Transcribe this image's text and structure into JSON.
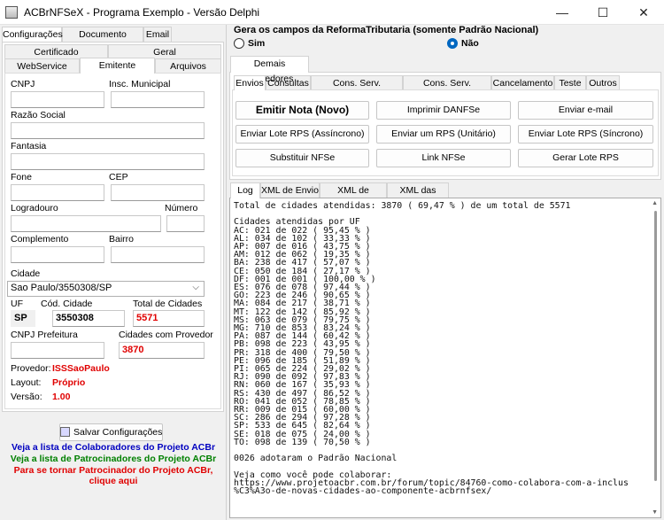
{
  "window": {
    "title": "ACBrNFSeX - Programa Exemplo - Versão Delphi",
    "minimize": "—",
    "maximize": "☐",
    "close": "✕"
  },
  "left": {
    "top_tabs": [
      "Configurações",
      "Documento Auxiliar",
      "Email"
    ],
    "tabs_row1": [
      "Certificado",
      "Geral"
    ],
    "tabs_row2": [
      "WebService",
      "Emitente",
      "Arquivos"
    ],
    "fields": {
      "cnpj_label": "CNPJ",
      "insc_municipal_label": "Insc. Municipal",
      "razao_social_label": "Razão Social",
      "fantasia_label": "Fantasia",
      "fone_label": "Fone",
      "cep_label": "CEP",
      "logradouro_label": "Logradouro",
      "numero_label": "Número",
      "complemento_label": "Complemento",
      "bairro_label": "Bairro",
      "cidade_label": "Cidade",
      "cidade_value": "Sao Paulo/3550308/SP",
      "uf_label": "UF",
      "uf_value": "SP",
      "cod_cidade_label": "Cód. Cidade",
      "cod_cidade_value": "3550308",
      "total_cidades_label": "Total de Cidades",
      "total_cidades_value": "5571",
      "cnpj_prefeitura_label": "CNPJ Prefeitura",
      "cidades_provedor_label": "Cidades com Provedor",
      "cidades_provedor_value": "3870"
    },
    "provedor": {
      "label": "Provedor:",
      "value": "ISSSaoPaulo"
    },
    "layout": {
      "label": "Layout:",
      "value": "Próprio"
    },
    "versao": {
      "label": "Versão:",
      "value": "1.00"
    },
    "save_button": "Salvar Configurações",
    "links": [
      {
        "text": "Veja a lista de Colaboradores do Projeto ACBr",
        "color": "#0000c0"
      },
      {
        "text": "Veja a lista de Patrocinadores do Projeto ACBr",
        "color": "#008000"
      },
      {
        "text": "Para se tornar Patrocinador do Projeto ACBr,",
        "color": "#e00000"
      },
      {
        "text": "clique aqui",
        "color": "#e00000"
      }
    ]
  },
  "right": {
    "reforma_title": "Gera os campos da ReformaTributaria (somente Padrão Nacional)",
    "radio_sim": "Sim",
    "radio_nao": "Não",
    "outer_tab": "Demais Provedores",
    "tabs": [
      "Envios",
      "Consultas",
      "Cons. Serv. Prestados",
      "Cons. Serv. Tomados",
      "Cancelamento",
      "Teste",
      "Outros"
    ],
    "buttons": [
      [
        "Emitir Nota (Novo)",
        "Imprimir DANFSe",
        "Enviar e-mail"
      ],
      [
        "Enviar Lote RPS (Assíncrono)",
        "Enviar um RPS (Unitário)",
        "Enviar Lote RPS (Síncrono)"
      ],
      [
        "Substituir NFSe",
        "Link NFSe",
        "Gerar Lote RPS"
      ]
    ],
    "log_tabs": [
      "Log",
      "XML de Envio",
      "XML de Retorno",
      "XML das Notas"
    ],
    "log_text": "Total de cidades atendidas: 3870 ( 69,47 % ) de um total de 5571\n\nCidades atendidas por UF\nAC: 021 de 022 ( 95,45 % )\nAL: 034 de 102 ( 33,33 % )\nAP: 007 de 016 ( 43,75 % )\nAM: 012 de 062 ( 19,35 % )\nBA: 238 de 417 ( 57,07 % )\nCE: 050 de 184 ( 27,17 % )\nDF: 001 de 001 ( 100,00 % )\nES: 076 de 078 ( 97,44 % )\nGO: 223 de 246 ( 90,65 % )\nMA: 084 de 217 ( 38,71 % )\nMT: 122 de 142 ( 85,92 % )\nMS: 063 de 079 ( 79,75 % )\nMG: 710 de 853 ( 83,24 % )\nPA: 087 de 144 ( 60,42 % )\nPB: 098 de 223 ( 43,95 % )\nPR: 318 de 400 ( 79,50 % )\nPE: 096 de 185 ( 51,89 % )\nPI: 065 de 224 ( 29,02 % )\nRJ: 090 de 092 ( 97,83 % )\nRN: 060 de 167 ( 35,93 % )\nRS: 430 de 497 ( 86,52 % )\nRO: 041 de 052 ( 78,85 % )\nRR: 009 de 015 ( 60,00 % )\nSC: 286 de 294 ( 97,28 % )\nSP: 533 de 645 ( 82,64 % )\nSE: 018 de 075 ( 24,00 % )\nTO: 098 de 139 ( 70,50 % )\n\n0026 adotaram o Padrão Nacional\n\nVeja como você pode colaborar:\nhttps://www.projetoacbr.com.br/forum/topic/84760-como-colabora-com-a-inclus\n%C3%A3o-de-novas-cidades-ao-componente-acbrnfsex/"
  }
}
